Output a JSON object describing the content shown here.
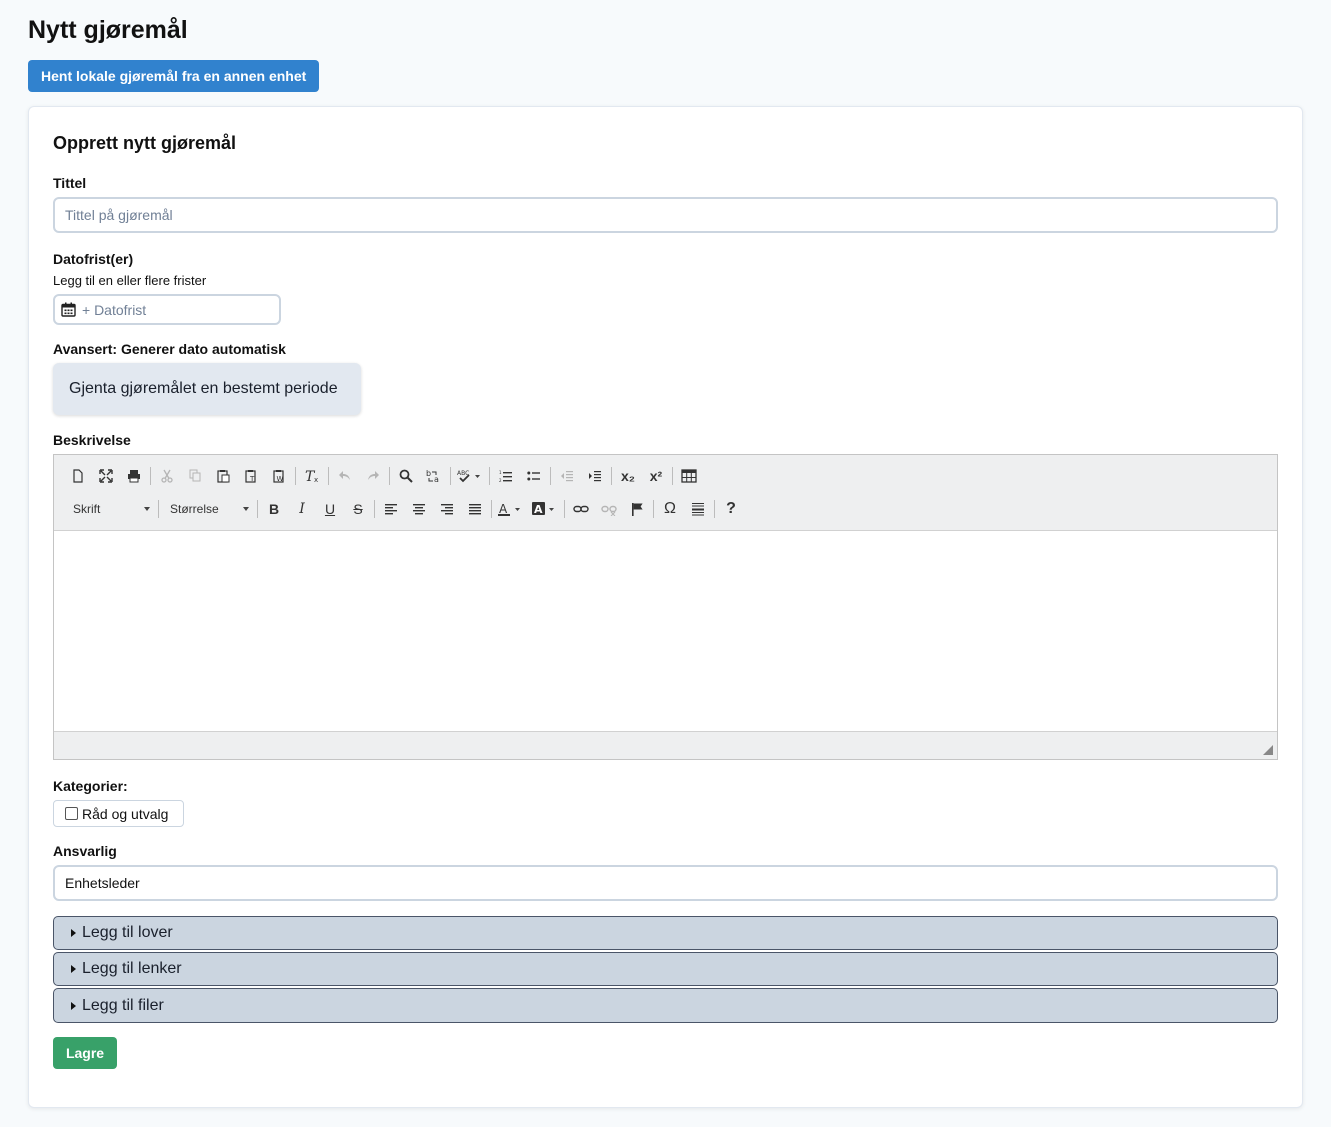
{
  "page": {
    "title": "Nytt gjøremål",
    "fetch_button": "Hent lokale gjøremål fra en annen enhet"
  },
  "form": {
    "heading": "Opprett nytt gjøremål",
    "title_label": "Tittel",
    "title_placeholder": "Tittel på gjøremål",
    "deadline_label": "Datofrist(er)",
    "deadline_help": "Legg til en eller flere frister",
    "deadline_placeholder": "+ Datofrist",
    "auto_date_label": "Avansert: Generer dato automatisk",
    "repeat_button": "Gjenta gjøremålet en bestemt periode",
    "description_label": "Beskrivelse",
    "categories_label": "Kategorier:",
    "category_option": "Råd og utvalg",
    "responsible_label": "Ansvarlig",
    "responsible_value": "Enhetsleder",
    "accordions": [
      "Legg til lover",
      "Legg til lenker",
      "Legg til filer"
    ],
    "save_button": "Lagre"
  },
  "editor": {
    "font_combo": "Skrift",
    "size_combo": "Størrelse",
    "bold": "B",
    "italic": "I",
    "underline": "U",
    "strike": "S",
    "omega": "Ω",
    "help": "?",
    "subscript": "x₂",
    "superscript": "x²"
  },
  "colors": {
    "primary": "#3182ce",
    "success": "#38a169",
    "accordion": "#cbd5e0"
  }
}
